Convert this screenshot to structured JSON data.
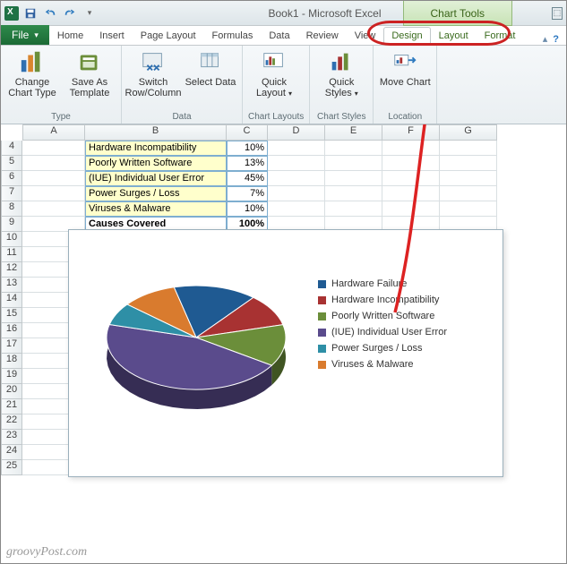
{
  "title": "Book1 - Microsoft Excel",
  "chart_tools_label": "Chart Tools",
  "window_controls": {
    "restore_down": "⎘",
    "app_min": "—"
  },
  "qat": {
    "save_tip": "Save",
    "undo_tip": "Undo",
    "redo_tip": "Redo"
  },
  "tabs": {
    "file": "File",
    "main": [
      "Home",
      "Insert",
      "Page Layout",
      "Formulas",
      "Data",
      "Review",
      "View"
    ],
    "context": [
      "Design",
      "Layout",
      "Format"
    ]
  },
  "help_icons": {
    "minimize_ribbon": "▴",
    "help": "?"
  },
  "ribbon_groups": {
    "type": {
      "label": "Type",
      "change": "Change Chart Type",
      "saveas": "Save As Template"
    },
    "data": {
      "label": "Data",
      "switch": "Switch Row/Column",
      "select": "Select Data"
    },
    "layouts": {
      "label": "Chart Layouts",
      "quick": "Quick Layout"
    },
    "styles": {
      "label": "Chart Styles",
      "quick": "Quick Styles"
    },
    "location": {
      "label": "Location",
      "move": "Move Chart"
    }
  },
  "columns": [
    "A",
    "B",
    "C",
    "D",
    "E",
    "F",
    "G"
  ],
  "rows_shown": [
    4,
    5,
    6,
    7,
    8,
    9,
    10,
    11,
    12,
    13,
    14,
    15,
    16,
    17,
    18,
    19,
    20,
    21,
    22,
    23,
    24,
    25
  ],
  "table": {
    "rows": [
      {
        "b": "Hardware Incompatibility",
        "c": "10%"
      },
      {
        "b": "Poorly Written Software",
        "c": "13%"
      },
      {
        "b": "(IUE) Individual User Error",
        "c": "45%"
      },
      {
        "b": "Power Surges / Loss",
        "c": "7%"
      },
      {
        "b": "Viruses & Malware",
        "c": "10%"
      }
    ],
    "total": {
      "b": "Causes Covered",
      "c": "100%"
    }
  },
  "chart_data": {
    "type": "pie",
    "series": [
      {
        "name": "Hardware Failure",
        "value": 15,
        "color": "#1f5a92"
      },
      {
        "name": "Hardware Incompatibility",
        "value": 10,
        "color": "#a83232"
      },
      {
        "name": "Poorly Written Software",
        "value": 13,
        "color": "#6b8e3a"
      },
      {
        "name": "(IUE) Individual User Error",
        "value": 45,
        "color": "#5a4b8c"
      },
      {
        "name": "Power Surges / Loss",
        "value": 7,
        "color": "#2e8fa6"
      },
      {
        "name": "Viruses & Malware",
        "value": 10,
        "color": "#d97b2e"
      }
    ]
  },
  "watermark": "groovyPost.com"
}
